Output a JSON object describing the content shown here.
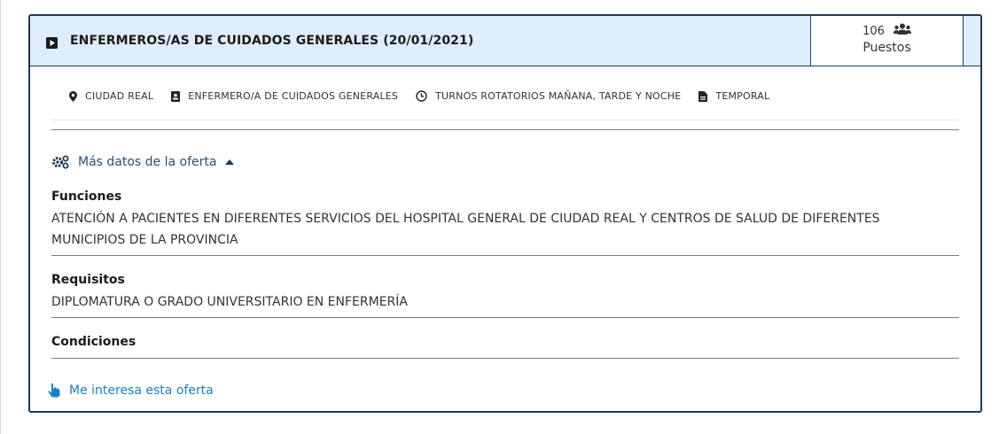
{
  "offer": {
    "title": "ENFERMEROS/AS DE CUIDADOS GENERALES (20/01/2021)",
    "posts_count": "106",
    "posts_label": "Puestos",
    "tags": [
      {
        "icon": "map-marker-icon",
        "label": "CIUDAD REAL"
      },
      {
        "icon": "id-badge-icon",
        "label": "ENFERMERO/A DE CUIDADOS GENERALES"
      },
      {
        "icon": "clock-icon",
        "label": "TURNOS ROTATORIOS MAÑANA, TARDE Y NOCHE"
      },
      {
        "icon": "document-icon",
        "label": "TEMPORAL"
      }
    ],
    "more_data_label": "Más datos de la oferta",
    "sections": [
      {
        "title": "Funciones",
        "text": "ATENCIÓN A PACIENTES EN DIFERENTES SERVICIOS DEL HOSPITAL GENERAL DE CIUDAD REAL Y CENTROS DE SALUD DE DIFERENTES MUNICIPIOS DE LA PROVINCIA"
      },
      {
        "title": "Requisitos",
        "text": "DIPLOMATURA O GRADO UNIVERSITARIO EN ENFERMERÍA"
      },
      {
        "title": "Condiciones",
        "text": ""
      }
    ],
    "interest_label": "Me interesa esta oferta"
  },
  "colors": {
    "header_bg": "#deedfb",
    "border": "#1f3b57",
    "link": "#1a7fc7"
  }
}
